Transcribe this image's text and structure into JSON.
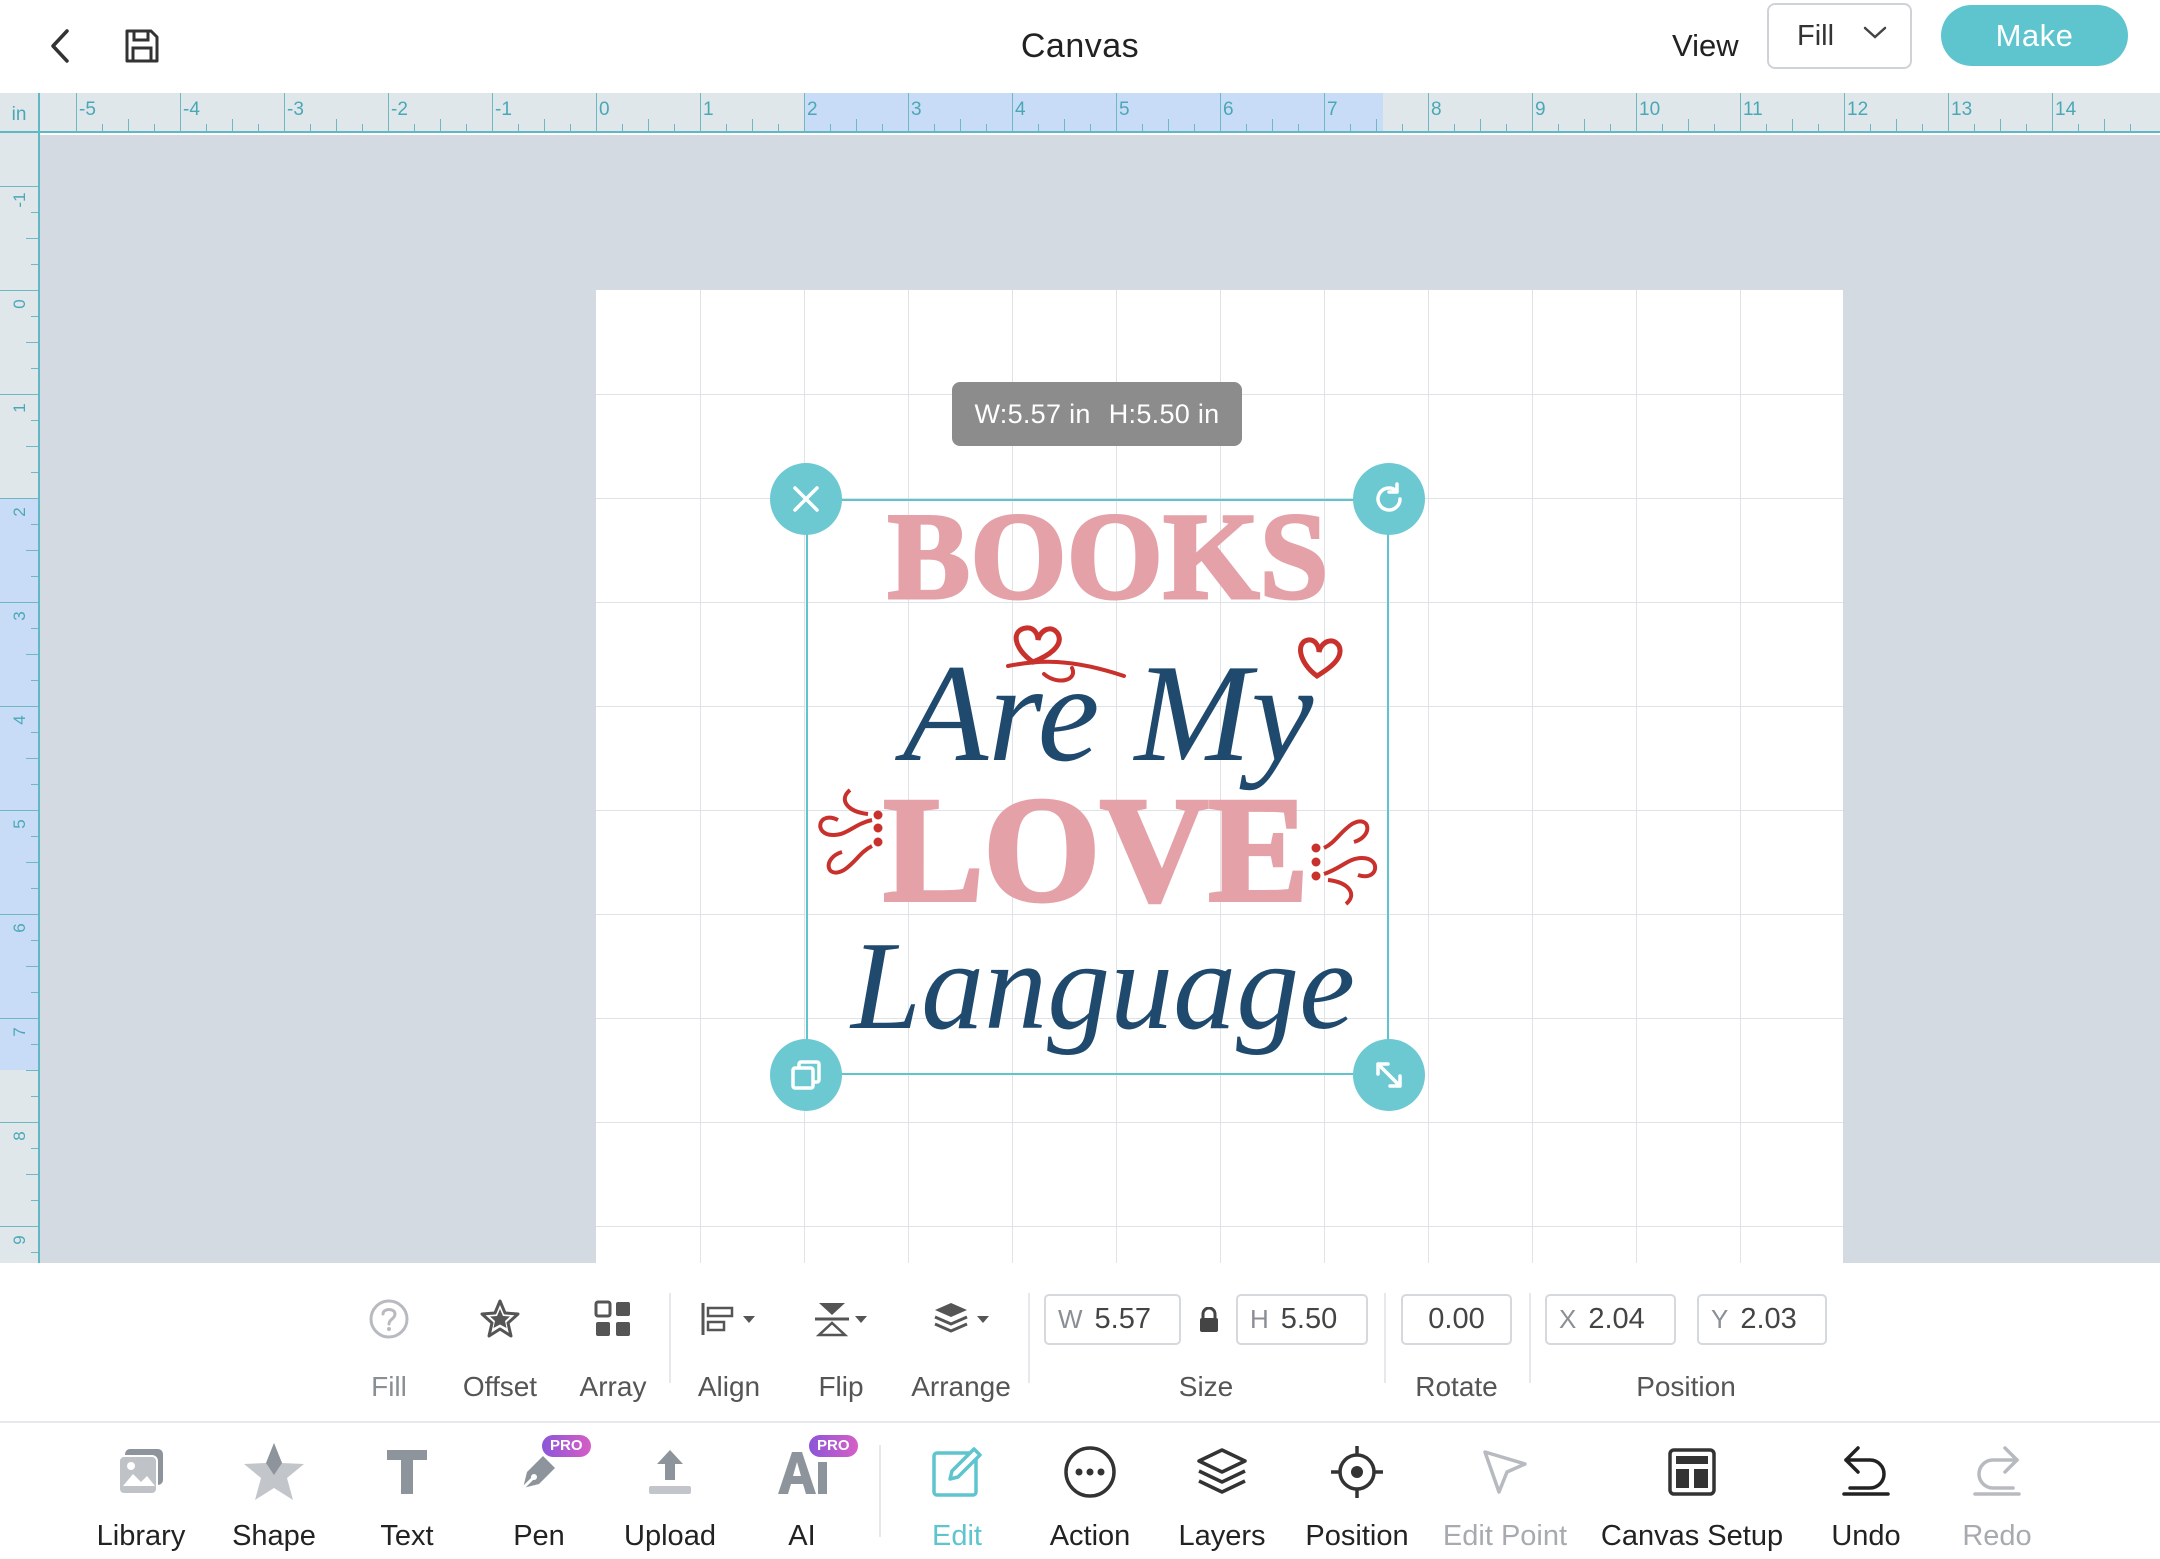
{
  "topbar": {
    "title": "Canvas",
    "view_label": "View",
    "view_value": "Fill",
    "make_label": "Make",
    "back_icon": "chevron-left-icon",
    "save_icon": "save-icon"
  },
  "ruler": {
    "unit": "in",
    "x_labels": [
      "-5",
      "-4",
      "-3",
      "-2",
      "-1",
      "0",
      "1",
      "2",
      "3",
      "4",
      "5",
      "6",
      "7",
      "8",
      "9",
      "10",
      "11",
      "12",
      "13",
      "14"
    ],
    "y_labels": [
      "-1",
      "0",
      "1",
      "2",
      "3",
      "4",
      "5",
      "6",
      "7",
      "8",
      "9"
    ],
    "highlight_x": [
      2,
      7.57
    ],
    "highlight_y": [
      2,
      7.5
    ]
  },
  "canvas": {
    "size_tooltip": {
      "w": "W:5.57 in",
      "h": "H:5.50 in"
    },
    "artwork": {
      "line1": "BOOKS",
      "line2": "Are My",
      "line3": "LOVE",
      "line4": "Language"
    },
    "handles": {
      "delete": "close-icon",
      "rotate": "rotate-icon",
      "duplicate": "duplicate-icon",
      "resize": "resize-icon"
    }
  },
  "properties": {
    "fill_label": "Fill",
    "offset_label": "Offset",
    "array_label": "Array",
    "align_label": "Align",
    "flip_label": "Flip",
    "arrange_label": "Arrange",
    "size_label": "Size",
    "width_prefix": "W",
    "width_value": "5.57",
    "height_prefix": "H",
    "height_value": "5.50",
    "rotate_label": "Rotate",
    "rotate_value": "0.00",
    "position_label": "Position",
    "x_prefix": "X",
    "x_value": "2.04",
    "y_prefix": "Y",
    "y_value": "2.03"
  },
  "bottom": {
    "items": [
      {
        "label": "Library",
        "icon": "image-icon"
      },
      {
        "label": "Shape",
        "icon": "star-icon"
      },
      {
        "label": "Text",
        "icon": "text-icon"
      },
      {
        "label": "Pen",
        "icon": "pen-icon",
        "badge": "PRO"
      },
      {
        "label": "Upload",
        "icon": "upload-icon"
      },
      {
        "label": "AI",
        "icon": "ai-icon",
        "badge": "PRO"
      },
      {
        "label": "Edit",
        "icon": "edit-icon",
        "state": "active"
      },
      {
        "label": "Action",
        "icon": "more-icon"
      },
      {
        "label": "Layers",
        "icon": "layers-icon"
      },
      {
        "label": "Position",
        "icon": "target-icon"
      },
      {
        "label": "Edit Point",
        "icon": "cursor-icon",
        "state": "disabled"
      },
      {
        "label": "Canvas Setup",
        "icon": "layout-icon"
      },
      {
        "label": "Undo",
        "icon": "undo-icon"
      },
      {
        "label": "Redo",
        "icon": "redo-icon",
        "state": "disabled"
      }
    ]
  },
  "colors": {
    "accent": "#5ec5cf",
    "pink": "#e4a2a8",
    "navy": "#1f4a6e",
    "red": "#c8312c",
    "workspace": "#d4dae1"
  }
}
